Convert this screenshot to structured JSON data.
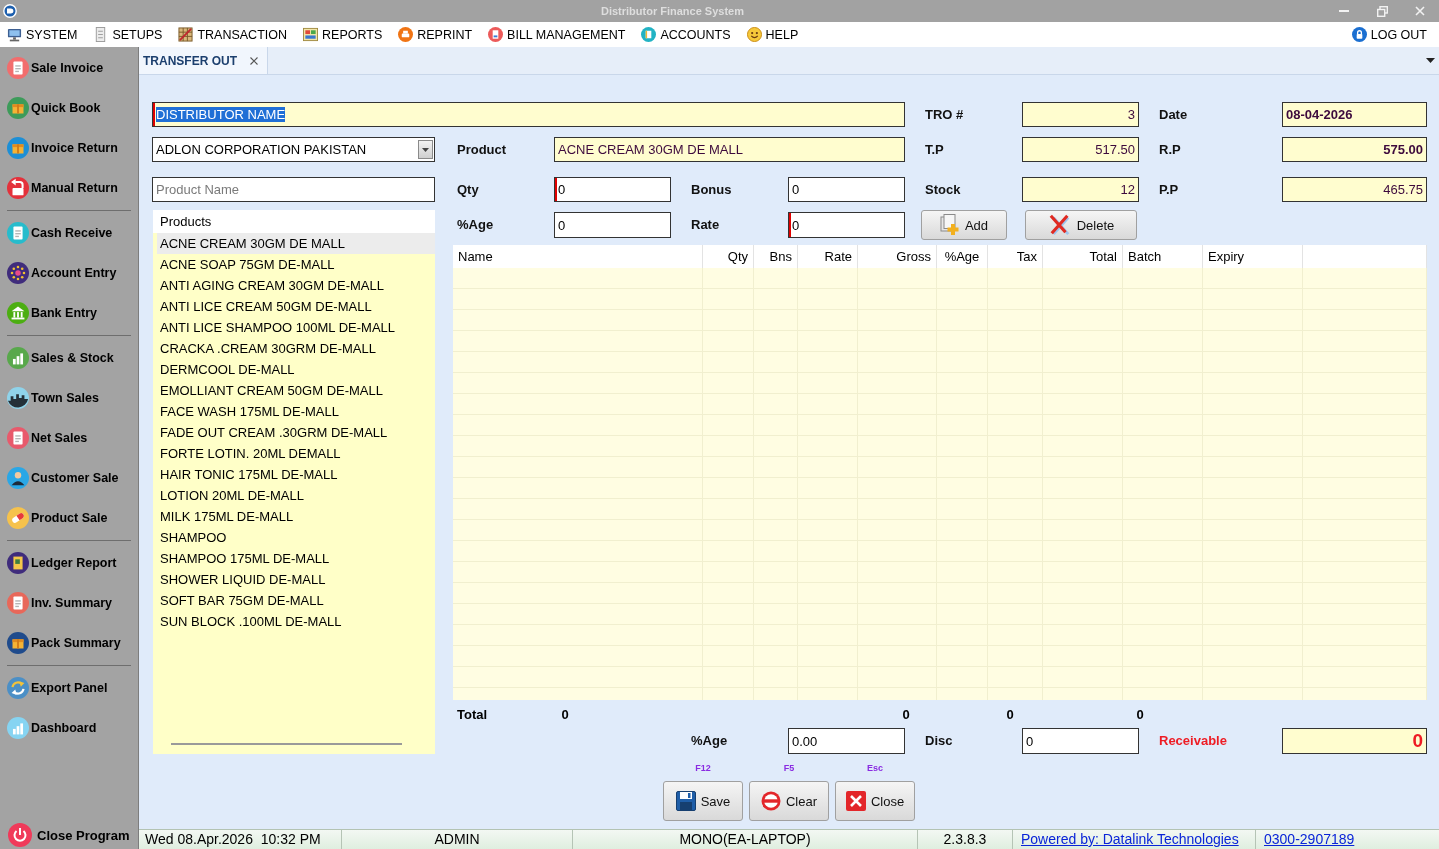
{
  "window": {
    "title": "Distributor Finance System"
  },
  "menu": [
    "SYSTEM",
    "SETUPS",
    "TRANSACTION",
    "REPORTS",
    "REPRINT",
    "BILL MANAGEMENT",
    "ACCOUNTS",
    "HELP"
  ],
  "logout": "LOG OUT",
  "sidebar": {
    "sections": [
      {
        "items": [
          "Sale Invoice",
          "Quick Book",
          "Invoice Return",
          "Manual Return"
        ]
      },
      {
        "items": [
          "Cash Receive",
          "Account Entry",
          "Bank Entry"
        ]
      },
      {
        "items": [
          "Sales & Stock",
          "Town Sales",
          "Net Sales",
          "Customer Sale",
          "Product Sale"
        ]
      },
      {
        "items": [
          "Ledger Report",
          "Inv. Summary",
          "Pack Summary"
        ]
      },
      {
        "items": [
          "Export Panel",
          "Dashboard"
        ]
      }
    ],
    "close_button": "Close Program"
  },
  "tabs": [
    {
      "label": "TRANSFER OUT",
      "selected": true
    }
  ],
  "form": {
    "distributor": {
      "value": "DISTRIBUTOR NAME",
      "readonly": true,
      "required": true,
      "highlighted": true
    },
    "tro": {
      "label": "TRO #",
      "value": "3",
      "readonly": true,
      "required": false
    },
    "date": {
      "label": "Date",
      "value": "08-04-2026",
      "readonly": true,
      "required": false
    },
    "company": {
      "value": "ADLON CORPORATION PAKISTAN"
    },
    "product": {
      "label": "Product",
      "value": "ACNE CREAM 30GM DE MALL",
      "readonly": true,
      "required": false
    },
    "tp": {
      "label": "T.P",
      "value": "517.50",
      "readonly": true,
      "required": false
    },
    "rp": {
      "label": "R.P",
      "value": "575.00",
      "readonly": true,
      "required": false
    },
    "product_search": {
      "placeholder": "Product Name",
      "readonly": false,
      "required": false
    },
    "qty": {
      "label": "Qty",
      "value": "0",
      "readonly": false,
      "required": true
    },
    "bonus": {
      "label": "Bonus",
      "value": "0",
      "readonly": false,
      "required": false
    },
    "stock": {
      "label": "Stock",
      "value": "12",
      "readonly": true,
      "required": false
    },
    "pp": {
      "label": "P.P",
      "value": "465.75",
      "readonly": true,
      "required": false
    },
    "percent": {
      "label": "%Age",
      "value": "0",
      "readonly": false,
      "required": false
    },
    "rate": {
      "label": "Rate",
      "value": "0",
      "readonly": false,
      "required": true
    }
  },
  "buttons": [
    "Add",
    "Delete"
  ],
  "products": {
    "header": "Products",
    "items": [
      {
        "label": "ACNE CREAM 30GM DE MALL",
        "selected": true
      },
      {
        "label": "ACNE SOAP 75GM DE-MALL",
        "selected": false
      },
      {
        "label": "ANTI AGING CREAM 30GM DE-MALL",
        "selected": false
      },
      {
        "label": "ANTI LICE CREAM 50GM DE-MALL",
        "selected": false
      },
      {
        "label": "ANTI LICE SHAMPOO 100ML DE-MALL",
        "selected": false
      },
      {
        "label": "CRACKA .CREAM 30GRM DE-MALL",
        "selected": false
      },
      {
        "label": "DERMCOOL DE-MALL",
        "selected": false
      },
      {
        "label": "EMOLLIANT CREAM 50GM DE-MALL",
        "selected": false
      },
      {
        "label": "FACE WASH 175ML DE-MALL",
        "selected": false
      },
      {
        "label": "FADE OUT CREAM .30GRM DE-MALL",
        "selected": false
      },
      {
        "label": "FORTE LOTIN. 20ML DEMALL",
        "selected": false
      },
      {
        "label": "HAIR TONIC 175ML DE-MALL",
        "selected": false
      },
      {
        "label": "LOTION 20ML DE-MALL",
        "selected": false
      },
      {
        "label": "MILK 175ML DE-MALL",
        "selected": false
      },
      {
        "label": "SHAMPOO",
        "selected": false
      },
      {
        "label": "SHAMPOO 175ML DE-MALL",
        "selected": false
      },
      {
        "label": "SHOWER LIQUID DE-MALL",
        "selected": false
      },
      {
        "label": "SOFT BAR 75GM DE-MALL",
        "selected": false
      },
      {
        "label": "SUN BLOCK .100ML DE-MALL",
        "selected": false
      }
    ]
  },
  "table": {
    "columns": [
      "Name",
      "Qty",
      "Bns",
      "Rate",
      "Gross",
      "%Age",
      "Tax",
      "Total",
      "Batch",
      "Expiry"
    ]
  },
  "totals": {
    "label": "Total",
    "values": [
      "0",
      "0",
      "0",
      "0"
    ]
  },
  "summary": {
    "percent": {
      "label": "%Age",
      "value": "0.00",
      "readonly": false,
      "required": false
    },
    "disc": {
      "label": "Disc",
      "value": "0",
      "readonly": false,
      "required": false
    },
    "receivable": {
      "label": "Receivable",
      "value": "0",
      "readonly": true,
      "required": false
    }
  },
  "actions": [
    {
      "label": "Save",
      "shortcut": "F12"
    },
    {
      "label": "Clear",
      "shortcut": "F5"
    },
    {
      "label": "Close",
      "shortcut": "Esc"
    }
  ],
  "status_bar": {
    "datetime": "Wed 08.Apr.2026  10:32 PM",
    "user": "ADMIN",
    "machine": "MONO(EA-LAPTOP)",
    "version": "2.3.8.3",
    "credit": "Powered by: Datalink Technologies",
    "phone": "0300-2907189"
  }
}
